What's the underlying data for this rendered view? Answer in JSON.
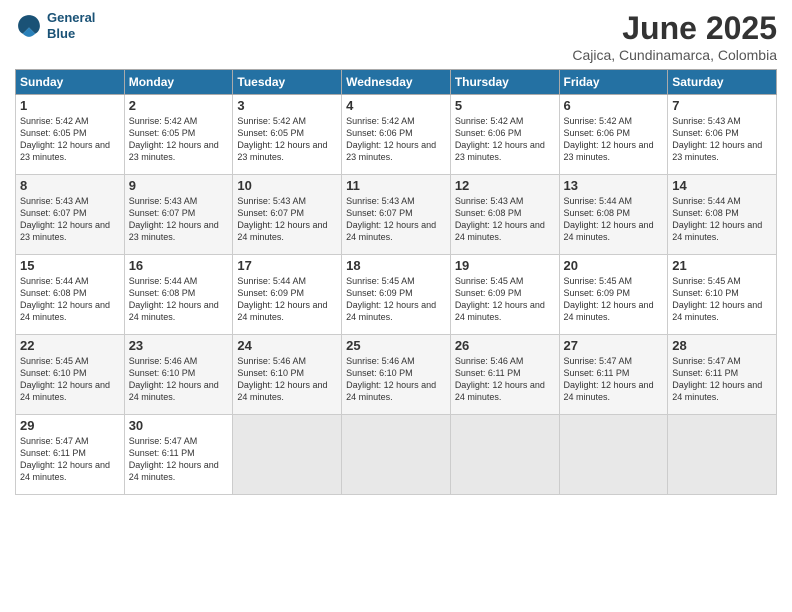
{
  "logo": {
    "line1": "General",
    "line2": "Blue"
  },
  "title": "June 2025",
  "subtitle": "Cajica, Cundinamarca, Colombia",
  "headers": [
    "Sunday",
    "Monday",
    "Tuesday",
    "Wednesday",
    "Thursday",
    "Friday",
    "Saturday"
  ],
  "weeks": [
    [
      {
        "day": 1,
        "info": "Sunrise: 5:42 AM\nSunset: 6:05 PM\nDaylight: 12 hours\nand 23 minutes."
      },
      {
        "day": 2,
        "info": "Sunrise: 5:42 AM\nSunset: 6:05 PM\nDaylight: 12 hours\nand 23 minutes."
      },
      {
        "day": 3,
        "info": "Sunrise: 5:42 AM\nSunset: 6:05 PM\nDaylight: 12 hours\nand 23 minutes."
      },
      {
        "day": 4,
        "info": "Sunrise: 5:42 AM\nSunset: 6:06 PM\nDaylight: 12 hours\nand 23 minutes."
      },
      {
        "day": 5,
        "info": "Sunrise: 5:42 AM\nSunset: 6:06 PM\nDaylight: 12 hours\nand 23 minutes."
      },
      {
        "day": 6,
        "info": "Sunrise: 5:42 AM\nSunset: 6:06 PM\nDaylight: 12 hours\nand 23 minutes."
      },
      {
        "day": 7,
        "info": "Sunrise: 5:43 AM\nSunset: 6:06 PM\nDaylight: 12 hours\nand 23 minutes."
      }
    ],
    [
      {
        "day": 8,
        "info": "Sunrise: 5:43 AM\nSunset: 6:07 PM\nDaylight: 12 hours\nand 23 minutes."
      },
      {
        "day": 9,
        "info": "Sunrise: 5:43 AM\nSunset: 6:07 PM\nDaylight: 12 hours\nand 23 minutes."
      },
      {
        "day": 10,
        "info": "Sunrise: 5:43 AM\nSunset: 6:07 PM\nDaylight: 12 hours\nand 24 minutes."
      },
      {
        "day": 11,
        "info": "Sunrise: 5:43 AM\nSunset: 6:07 PM\nDaylight: 12 hours\nand 24 minutes."
      },
      {
        "day": 12,
        "info": "Sunrise: 5:43 AM\nSunset: 6:08 PM\nDaylight: 12 hours\nand 24 minutes."
      },
      {
        "day": 13,
        "info": "Sunrise: 5:44 AM\nSunset: 6:08 PM\nDaylight: 12 hours\nand 24 minutes."
      },
      {
        "day": 14,
        "info": "Sunrise: 5:44 AM\nSunset: 6:08 PM\nDaylight: 12 hours\nand 24 minutes."
      }
    ],
    [
      {
        "day": 15,
        "info": "Sunrise: 5:44 AM\nSunset: 6:08 PM\nDaylight: 12 hours\nand 24 minutes."
      },
      {
        "day": 16,
        "info": "Sunrise: 5:44 AM\nSunset: 6:08 PM\nDaylight: 12 hours\nand 24 minutes."
      },
      {
        "day": 17,
        "info": "Sunrise: 5:44 AM\nSunset: 6:09 PM\nDaylight: 12 hours\nand 24 minutes."
      },
      {
        "day": 18,
        "info": "Sunrise: 5:45 AM\nSunset: 6:09 PM\nDaylight: 12 hours\nand 24 minutes."
      },
      {
        "day": 19,
        "info": "Sunrise: 5:45 AM\nSunset: 6:09 PM\nDaylight: 12 hours\nand 24 minutes."
      },
      {
        "day": 20,
        "info": "Sunrise: 5:45 AM\nSunset: 6:09 PM\nDaylight: 12 hours\nand 24 minutes."
      },
      {
        "day": 21,
        "info": "Sunrise: 5:45 AM\nSunset: 6:10 PM\nDaylight: 12 hours\nand 24 minutes."
      }
    ],
    [
      {
        "day": 22,
        "info": "Sunrise: 5:45 AM\nSunset: 6:10 PM\nDaylight: 12 hours\nand 24 minutes."
      },
      {
        "day": 23,
        "info": "Sunrise: 5:46 AM\nSunset: 6:10 PM\nDaylight: 12 hours\nand 24 minutes."
      },
      {
        "day": 24,
        "info": "Sunrise: 5:46 AM\nSunset: 6:10 PM\nDaylight: 12 hours\nand 24 minutes."
      },
      {
        "day": 25,
        "info": "Sunrise: 5:46 AM\nSunset: 6:10 PM\nDaylight: 12 hours\nand 24 minutes."
      },
      {
        "day": 26,
        "info": "Sunrise: 5:46 AM\nSunset: 6:11 PM\nDaylight: 12 hours\nand 24 minutes."
      },
      {
        "day": 27,
        "info": "Sunrise: 5:47 AM\nSunset: 6:11 PM\nDaylight: 12 hours\nand 24 minutes."
      },
      {
        "day": 28,
        "info": "Sunrise: 5:47 AM\nSunset: 6:11 PM\nDaylight: 12 hours\nand 24 minutes."
      }
    ],
    [
      {
        "day": 29,
        "info": "Sunrise: 5:47 AM\nSunset: 6:11 PM\nDaylight: 12 hours\nand 24 minutes."
      },
      {
        "day": 30,
        "info": "Sunrise: 5:47 AM\nSunset: 6:11 PM\nDaylight: 12 hours\nand 24 minutes."
      },
      null,
      null,
      null,
      null,
      null
    ]
  ]
}
